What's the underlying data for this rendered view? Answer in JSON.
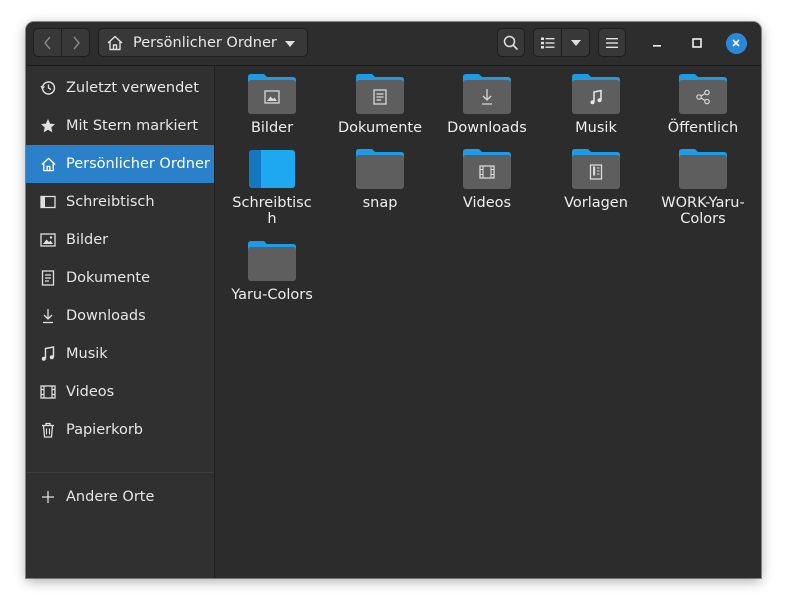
{
  "window": {
    "path_label": "Persönlicher Ordner"
  },
  "header": {
    "icons": [
      "go-back-icon",
      "go-forward-icon",
      "home-icon",
      "chevron-down-icon",
      "search-icon",
      "list-view-icon",
      "view-options-chevron-icon",
      "hamburger-menu-icon",
      "minimize-icon",
      "maximize-icon",
      "close-icon"
    ]
  },
  "sidebar": {
    "items": [
      {
        "label": "Zuletzt verwendet",
        "icon": "recent-icon",
        "active": false
      },
      {
        "label": "Mit Stern markiert",
        "icon": "star-icon",
        "active": false
      },
      {
        "label": "Persönlicher Ordner",
        "icon": "home-icon",
        "active": true
      },
      {
        "label": "Schreibtisch",
        "icon": "desktop-icon",
        "active": false
      },
      {
        "label": "Bilder",
        "icon": "pictures-icon",
        "active": false
      },
      {
        "label": "Dokumente",
        "icon": "documents-icon",
        "active": false
      },
      {
        "label": "Downloads",
        "icon": "downloads-icon",
        "active": false
      },
      {
        "label": "Musik",
        "icon": "music-icon",
        "active": false
      },
      {
        "label": "Videos",
        "icon": "videos-icon",
        "active": false
      },
      {
        "label": "Papierkorb",
        "icon": "trash-icon",
        "active": false
      }
    ],
    "other_locations": {
      "label": "Andere Orte",
      "icon": "plus-icon"
    }
  },
  "files": [
    {
      "label": "Bilder",
      "emblem": "pictures-emblem"
    },
    {
      "label": "Dokumente",
      "emblem": "documents-emblem"
    },
    {
      "label": "Downloads",
      "emblem": "downloads-emblem"
    },
    {
      "label": "Musik",
      "emblem": "music-emblem"
    },
    {
      "label": "Öffentlich",
      "emblem": "share-emblem"
    },
    {
      "label": "Schreibtisch",
      "emblem": "desktop-folder"
    },
    {
      "label": "snap",
      "emblem": "none"
    },
    {
      "label": "Videos",
      "emblem": "videos-emblem"
    },
    {
      "label": "Vorlagen",
      "emblem": "templates-emblem"
    },
    {
      "label": "WORK-Yaru-Colors",
      "emblem": "none"
    },
    {
      "label": "Yaru-Colors",
      "emblem": "none"
    }
  ],
  "colors": {
    "accent": "#2b81c9",
    "folder_tab": "#1e9be6",
    "folder_body": "#5e5e5e",
    "close_button": "#2a88d8",
    "window_bg": "#2c2c2c",
    "sidebar_bg": "#303030"
  }
}
